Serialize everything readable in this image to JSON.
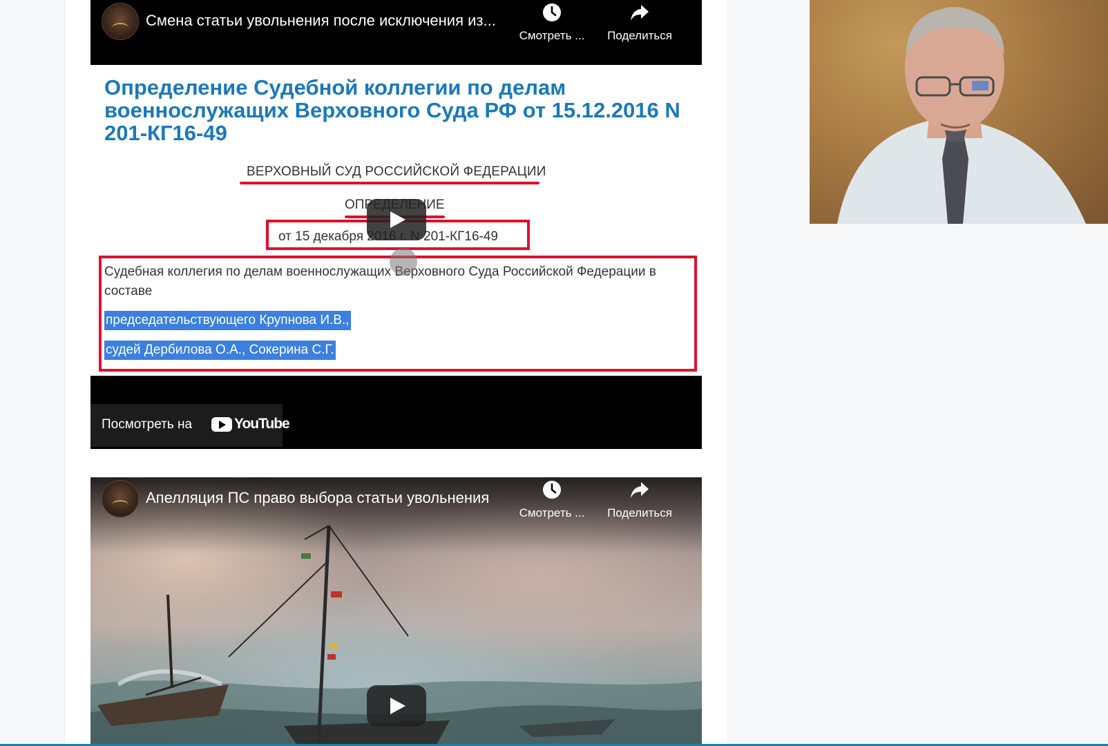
{
  "video1": {
    "title": "Смена статьи увольнения после исключения из...",
    "watch_later_label": "Смотреть ...",
    "share_label": "Поделиться",
    "document": {
      "heading": "Определение Судебной коллегии по делам военнослужащих Верховного Суда РФ от 15.12.2016 N 201-КГ16-49",
      "court": "ВЕРХОВНЫЙ СУД РОССИЙСКОЙ ФЕДЕРАЦИИ",
      "kind": "ОПРЕДЕЛЕНИЕ",
      "date_line": "от 15 декабря 2016 г. N 201-КГ16-49",
      "body_intro": "Судебная коллегия по делам военнослужащих Верховного Суда Российской Федерации в составе",
      "highlight_1": "председательствующего Крупнова И.В.,",
      "highlight_2": "судей Дербилова О.А., Сокерина С.Г."
    },
    "watch_on_label": "Посмотреть на",
    "youtube_word": "YouTube"
  },
  "video2": {
    "title": "Апелляция ПС право выбора статьи увольнения",
    "watch_later_label": "Смотреть ...",
    "share_label": "Поделиться"
  },
  "colors": {
    "heading_blue": "#1a79b8",
    "markup_red": "#e0102d",
    "highlight_blue": "#3b7fe0",
    "bottom_accent": "#1e7fa6"
  },
  "icons": [
    "clock-icon",
    "share-arrow-icon",
    "play-icon",
    "youtube-logo-icon",
    "channel-avatar"
  ]
}
